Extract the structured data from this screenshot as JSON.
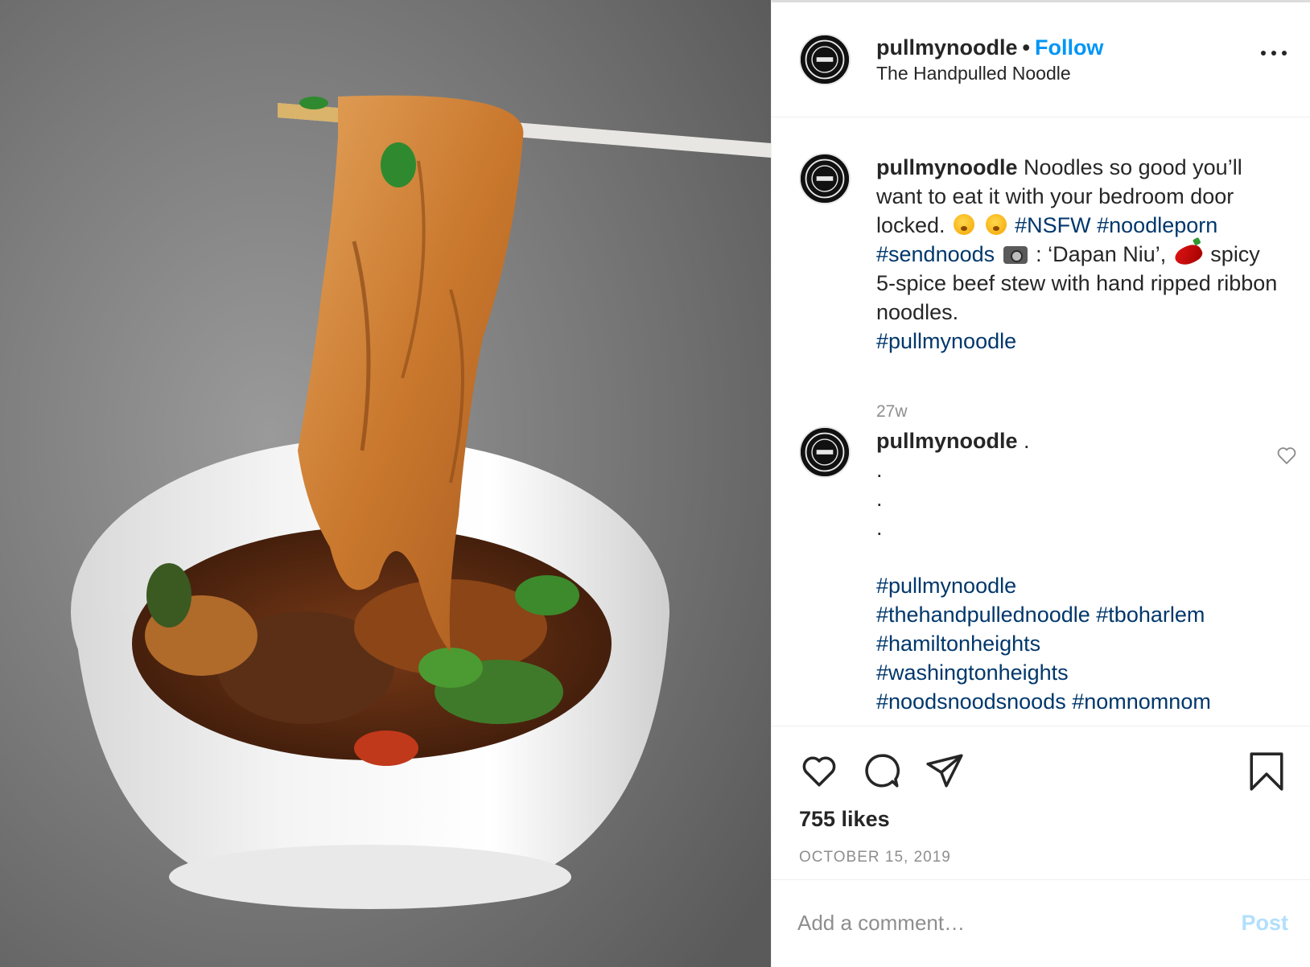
{
  "post": {
    "username": "pullmynoodle",
    "separator": "•",
    "follow_label": "Follow",
    "location": "The Handpulled Noodle"
  },
  "caption": {
    "username": "pullmynoodle",
    "text_1": "Noodles so good you’ll want to eat it with your bedroom door locked.",
    "tag_nsfw": "#NSFW",
    "tag_noodleporn": "#noodleporn",
    "tag_sendnoods": "#sendnoods",
    "text_2": ": ‘Dapan Niu’,",
    "text_3": "spicy 5-spice beef stew with hand ripped ribbon noodles.",
    "tag_pullmynoodle": "#pullmynoodle",
    "time": "27w"
  },
  "comment": {
    "username": "pullmynoodle",
    "text": ".",
    "dots": [
      ".",
      ".",
      "."
    ],
    "tags": [
      "#pullmynoodle",
      "#thehandpullednoodle",
      "#tboharlem",
      "#hamiltonheights",
      "#washingtonheights",
      "#noodsnoodsnoods",
      "#nomnomnom"
    ]
  },
  "actions": {
    "likes": "755 likes",
    "date": "OCTOBER 15, 2019"
  },
  "add_comment": {
    "placeholder": "Add a comment…",
    "post_label": "Post"
  },
  "colors": {
    "link_blue": "#0095f6",
    "hashtag": "#00376b",
    "post_disabled": "#b2dffc",
    "muted": "#8e8e8e"
  }
}
